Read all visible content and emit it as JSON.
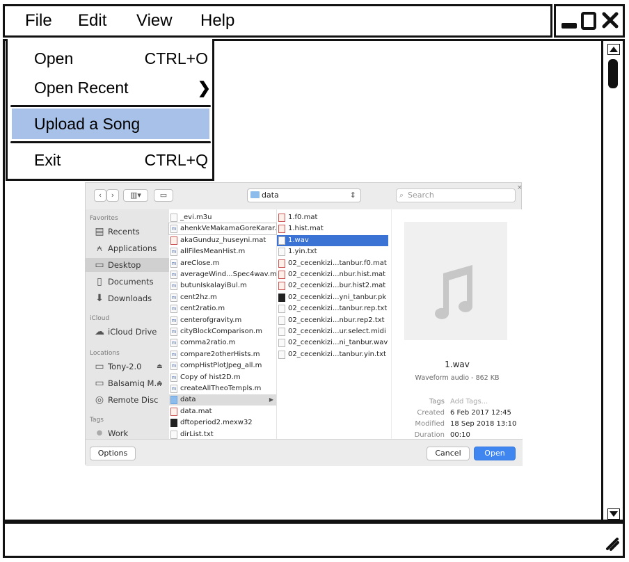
{
  "menubar": {
    "items": [
      "File",
      "Edit",
      "View",
      "Help"
    ]
  },
  "window_controls": {
    "minimize": "minimize-icon",
    "maximize": "maximize-icon",
    "close": "close-icon"
  },
  "file_menu": {
    "open": {
      "label": "Open",
      "shortcut": "CTRL+O"
    },
    "open_recent": {
      "label": "Open Recent",
      "arrow": "❯"
    },
    "upload": {
      "label": "Upload a Song"
    },
    "exit": {
      "label": "Exit",
      "shortcut": "CTRL+Q"
    }
  },
  "dialog": {
    "path": "data",
    "search_placeholder": "Search",
    "sidebar": {
      "favorites_heading": "Favorites",
      "favorites": [
        "Recents",
        "Applications",
        "Desktop",
        "Documents",
        "Downloads"
      ],
      "icloud_heading": "iCloud",
      "icloud": [
        "iCloud Drive"
      ],
      "locations_heading": "Locations",
      "locations": [
        "Tony-2.0",
        "Balsamiq M...",
        "Remote Disc"
      ],
      "tags_heading": "Tags",
      "tags": [
        "Work"
      ]
    },
    "column1": [
      "_evi.m3u",
      "ahenkVeMakamaGoreKarar.m",
      "akaGunduz_huseyni.mat",
      "allFilesMeanHist.m",
      "areClose.m",
      "averageWind...Spec4wav.m",
      "butunIskalayiBul.m",
      "cent2hz.m",
      "cent2ratio.m",
      "centerofgravity.m",
      "cityBlockComparison.m",
      "comma2ratio.m",
      "compare2otherHists.m",
      "compHistPlotJpeg_all.m",
      "Copy of hist2D.m",
      "createAllTheoTempls.m",
      "data",
      "data.mat",
      "dftoperiod2.mexw32",
      "dirList.txt"
    ],
    "column2": [
      "1.f0.mat",
      "1.hist.mat",
      "1.wav",
      "1.yin.txt",
      "02_cecenkizi...tanbur.f0.mat",
      "02_cecenkizi...nbur.hist.mat",
      "02_cecenkizi...bur.hist2.mat",
      "02_cecenkizi...yni_tanbur.pk",
      "02_cecenkizi...tanbur.rep.txt",
      "02_cecenkizi...nbur.rep2.txt",
      "02_cecenkizi...ur.select.midi",
      "02_cecenkizi...ni_tanbur.wav",
      "02_cecenkizi...tanbur.yin.txt"
    ],
    "preview": {
      "filename": "1.wav",
      "kind": "Waveform audio - 862 KB",
      "tags_label": "Tags",
      "tags_value": "Add Tags...",
      "created_label": "Created",
      "created_value": "6 Feb 2017 12:45",
      "modified_label": "Modified",
      "modified_value": "18 Sep 2018 13:10",
      "duration_label": "Duration",
      "duration_value": "00:10"
    },
    "buttons": {
      "options": "Options",
      "cancel": "Cancel",
      "open": "Open"
    }
  },
  "scrollbar": {
    "up": "scroll-up-icon",
    "down": "scroll-down-icon"
  },
  "statusbar": {
    "resize": "resize-grip-icon"
  }
}
